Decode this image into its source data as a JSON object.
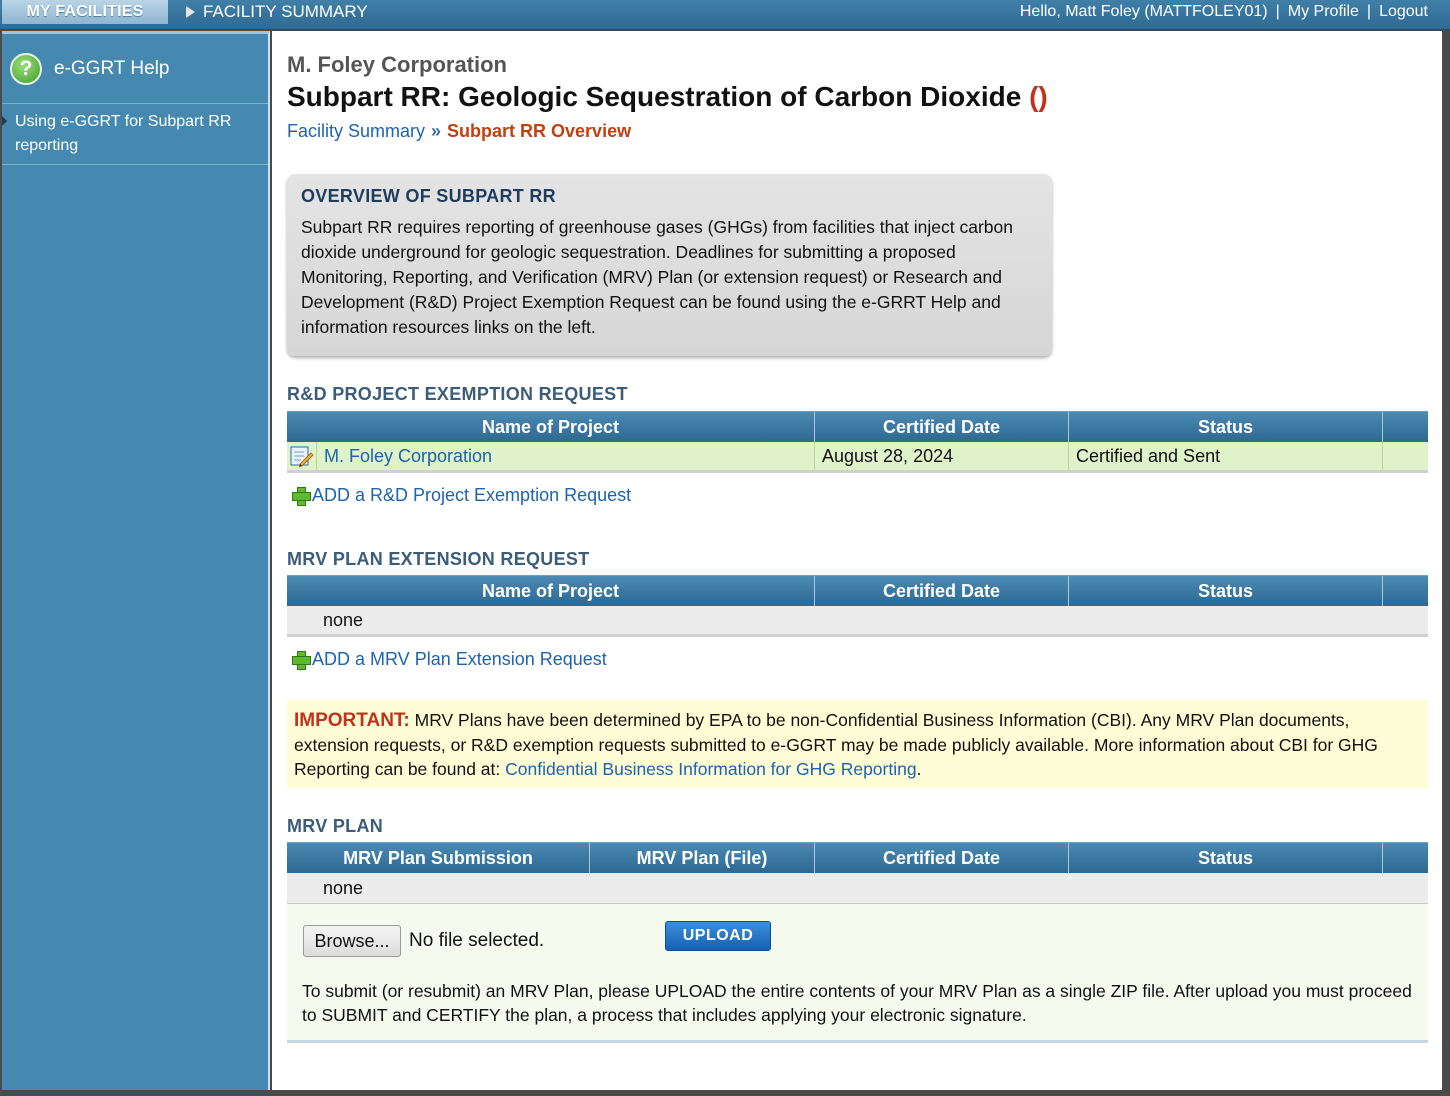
{
  "topbar": {
    "my_facilities": "MY FACILITIES",
    "facility_summary": "FACILITY SUMMARY",
    "greeting": "Hello, Matt Foley (MATTFOLEY01)",
    "my_profile": "My Profile",
    "logout": "Logout",
    "separator": "|"
  },
  "sidebar": {
    "help_label": "e-GGRT Help",
    "help_glyph": "?",
    "link": "Using e-GGRT for Subpart RR reporting"
  },
  "header": {
    "org": "M. Foley Corporation",
    "title": "Subpart RR: Geologic Sequestration of Carbon Dioxide",
    "title_paren": "()",
    "crumb_1": "Facility Summary",
    "crumb_sep": "»",
    "crumb_current": "Subpart RR Overview"
  },
  "overview": {
    "heading": "OVERVIEW OF SUBPART RR",
    "body": "Subpart RR requires reporting of greenhouse gases (GHGs) from facilities that inject carbon dioxide underground for geologic sequestration. Deadlines for submitting a proposed Monitoring, Reporting, and Verification (MRV) Plan (or extension request) or Research and Development (R&D) Project Exemption Request can be found using the e-GRRT Help and information resources links on the left."
  },
  "rd": {
    "title": "R&D PROJECT EXEMPTION REQUEST",
    "headers": [
      "Name of Project",
      "Certified Date",
      "Status"
    ],
    "rows": [
      {
        "name": "M. Foley Corporation",
        "date": "August 28, 2024",
        "status": "Certified and Sent"
      }
    ],
    "add": "ADD a R&D Project Exemption Request"
  },
  "ext": {
    "title": "MRV PLAN EXTENSION REQUEST",
    "headers": [
      "Name of Project",
      "Certified Date",
      "Status"
    ],
    "empty": "none",
    "add": "ADD a MRV Plan Extension Request"
  },
  "important": {
    "label": "IMPORTANT:",
    "text": " MRV Plans have been determined by EPA to be non-Confidential Business Information (CBI). Any MRV Plan documents, extension requests, or R&D exemption requests submitted to e-GGRT may be made publicly available. More information about CBI for GHG Reporting can be found at: ",
    "link": "Confidential Business Information for GHG Reporting",
    "end": "."
  },
  "mrv": {
    "title": "MRV PLAN",
    "headers": [
      "MRV Plan Submission",
      "MRV Plan (File)",
      "Certified Date",
      "Status"
    ],
    "empty": "none",
    "browse": "Browse...",
    "no_file": "No file selected.",
    "upload": "UPLOAD",
    "instructions": "To submit (or resubmit) an MRV Plan, please UPLOAD the entire contents of your MRV Plan as a single ZIP file. After upload you must proceed to SUBMIT and CERTIFY the plan, a process that includes applying your electronic signature."
  }
}
